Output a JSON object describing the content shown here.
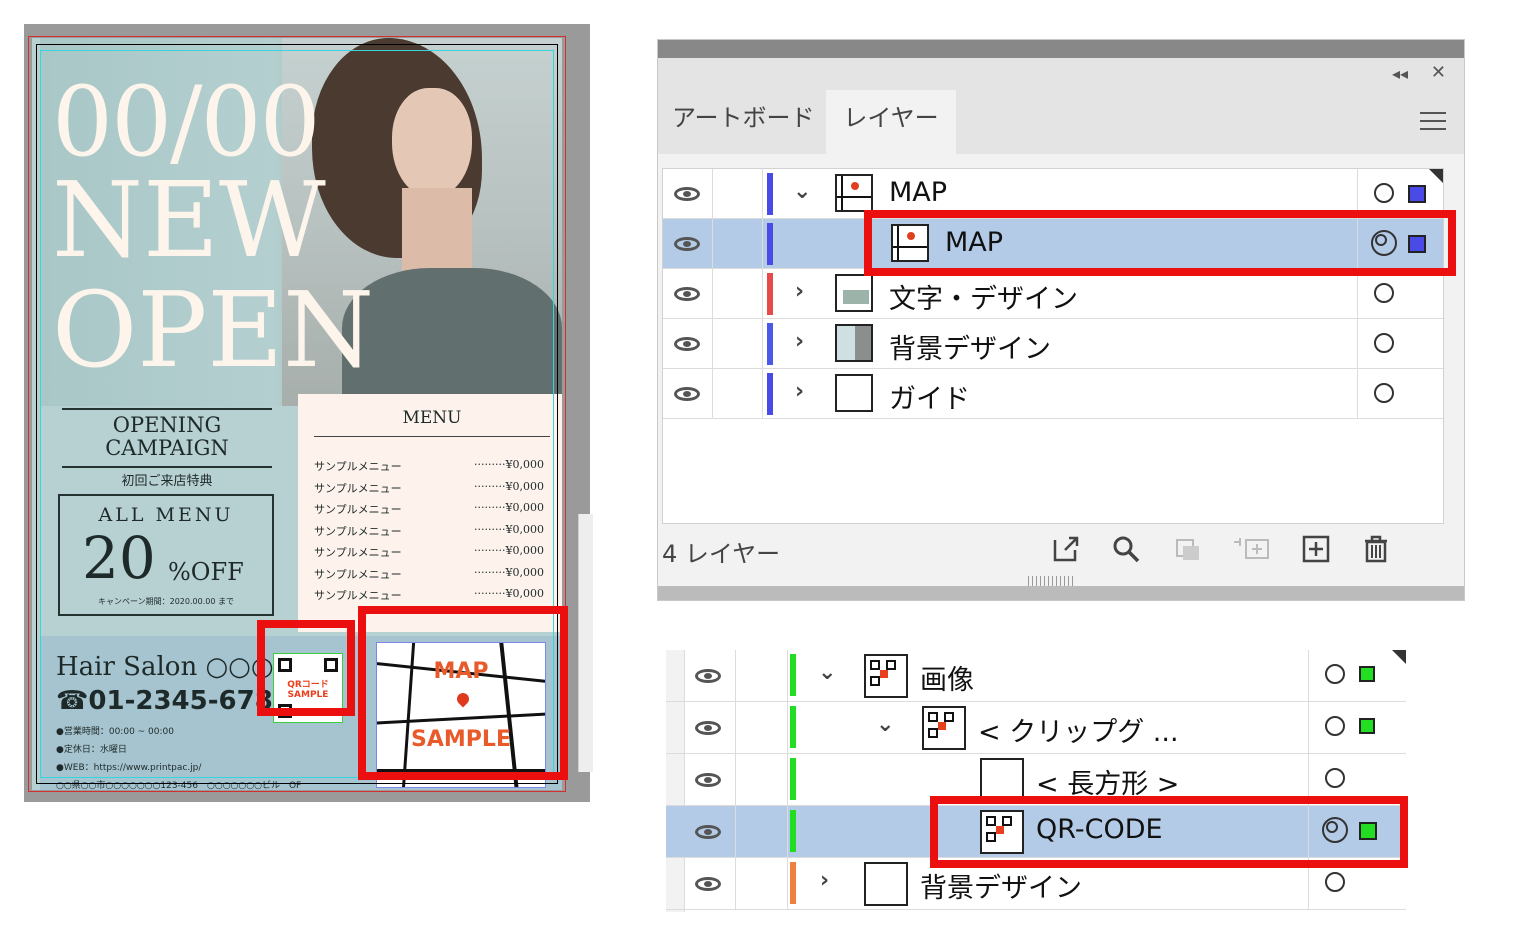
{
  "flyer": {
    "date": "00/00",
    "headline_1": "NEW",
    "headline_2": "OPEN",
    "campaign_line1": "OPENING",
    "campaign_line2": "CAMPAIGN",
    "campaign_sub": "初回ご来店特典",
    "allmenu_label": "ALL MENU",
    "allmenu_number": "20",
    "allmenu_percent": "%OFF",
    "allmenu_note": "キャンペーン期間：2020.00.00 まで",
    "menu_title": "MENU",
    "menu_items": [
      {
        "name": "サンプルメニュー",
        "price": "·········¥0,000"
      },
      {
        "name": "サンプルメニュー",
        "price": "·········¥0,000"
      },
      {
        "name": "サンプルメニュー",
        "price": "·········¥0,000"
      },
      {
        "name": "サンプルメニュー",
        "price": "·········¥0,000"
      },
      {
        "name": "サンプルメニュー",
        "price": "·········¥0,000"
      },
      {
        "name": "サンプルメニュー",
        "price": "·········¥0,000"
      },
      {
        "name": "サンプルメニュー",
        "price": "·········¥0,000"
      }
    ],
    "salon_name": "Hair Salon ○○○",
    "salon_phone": "☎01-2345-6789",
    "info_hours": "●営業時間：00:00 ~ 00:00",
    "info_closed": "●定休日：水曜日",
    "info_web": "●WEB：https://www.printpac.jp/",
    "info_address": "○○県○○市○○○○○○○123-456　○○○○○○○ビル　OF",
    "qr_label_1": "QRコード",
    "qr_label_2": "SAMPLE",
    "map_label_top": "MAP",
    "map_label_bottom": "SAMPLE"
  },
  "layers_panel": {
    "tabs": {
      "artboard": "アートボード",
      "layers": "レイヤー"
    },
    "collapse_glyph": "◂◂",
    "close_glyph": "✕",
    "rows": [
      {
        "name": "MAP",
        "color": "#4a4ae6",
        "expanded": true
      },
      {
        "name": "MAP",
        "color": "#4a4ae6",
        "selected": true
      },
      {
        "name": "文字・デザイン",
        "color": "#e64a4a"
      },
      {
        "name": "背景デザイン",
        "color": "#4a5ae6"
      },
      {
        "name": "ガイド",
        "color": "#4a4ae6"
      }
    ],
    "layer_count": "4 レイヤー",
    "chevron_down": "⌄",
    "chevron_right": "›"
  },
  "sub_panel": {
    "rows": [
      {
        "name": "画像",
        "color": "#22dd22"
      },
      {
        "name": "< クリップグ ...",
        "color": "#22dd22"
      },
      {
        "name": "< 長方形 >",
        "color": "#22dd22"
      },
      {
        "name": "QR-CODE",
        "color": "#22dd22",
        "selected": true
      },
      {
        "name": "背景デザイン",
        "color": "#f08040"
      }
    ]
  },
  "colors": {
    "highlight": "#ec0f0f",
    "selection": "#b4cbe8",
    "layer_blue": "#4a4ae6",
    "layer_green": "#22dd22"
  }
}
